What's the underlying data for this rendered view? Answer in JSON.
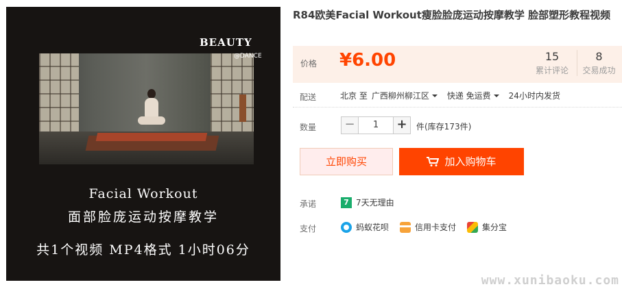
{
  "image": {
    "brand": "BEAUTY",
    "brand_sub": "@DANCE",
    "line1": "Facial Workout",
    "line2": "面部脸庞运动按摩教学",
    "line3": "共1个视频  MP4格式  1小时06分"
  },
  "product": {
    "title": "R84欧美Facial Workout瘦脸脸庞运动按摩教学 脸部塑形教程视频"
  },
  "price": {
    "label": "价格",
    "value": "¥6.00",
    "reviews_count": "15",
    "reviews_label": "累计评论",
    "sales_count": "8",
    "sales_label": "交易成功"
  },
  "shipping": {
    "label": "配送",
    "from": "北京 至",
    "to": "广西柳州柳江区",
    "method": "快递 免运费",
    "dispatch": "24小时内发货"
  },
  "quantity": {
    "label": "数量",
    "minus": "−",
    "value": "1",
    "plus": "+",
    "stock": "件(库存173件)"
  },
  "actions": {
    "buy_now": "立即购买",
    "add_cart": "加入购物车"
  },
  "promise": {
    "label": "承诺",
    "icon_text": "7",
    "text": "7天无理由"
  },
  "payment": {
    "label": "支付",
    "methods": [
      "蚂蚁花呗",
      "信用卡支付",
      "集分宝"
    ]
  },
  "watermark": "www.xunibaoku.com",
  "colors": {
    "accent": "#ff4400",
    "price_bg": "#fdf0e8",
    "promise_green": "#1aad6c"
  }
}
